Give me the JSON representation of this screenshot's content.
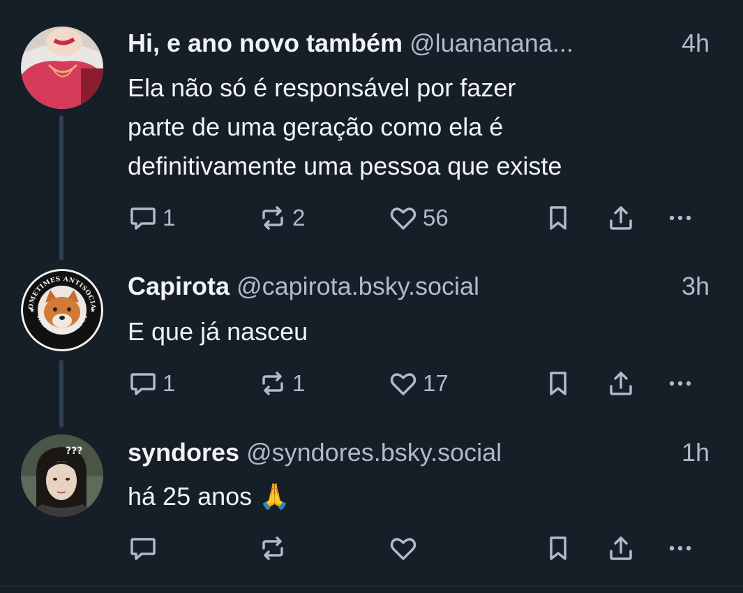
{
  "posts": [
    {
      "display_name": "Hi, e ano novo também",
      "handle": "@luananana...",
      "time": "4h",
      "text_lines": [
        "Ela não só é responsável por fazer",
        "parte de uma geração como ela é",
        "definitivamente uma pessoa que existe"
      ],
      "replies": "1",
      "reposts": "2",
      "likes": "56",
      "avatar_icon": "woman-in-pink-avatar"
    },
    {
      "display_name": "Capirota",
      "handle": "@capirota.bsky.social",
      "time": "3h",
      "text_lines": [
        "E que já nasceu"
      ],
      "replies": "1",
      "reposts": "1",
      "likes": "17",
      "avatar_icon": "fox-badge-avatar",
      "avatar_badge_top": "SOMETIMES ANTISOCIAL",
      "avatar_badge_bottom": "ALWAYS ANTIFASCIST"
    },
    {
      "display_name": "syndores",
      "handle": "@syndores.bsky.social",
      "time": "1h",
      "text_lines": [
        "há 25 anos 🙏"
      ],
      "replies": "",
      "reposts": "",
      "likes": "",
      "avatar_icon": "dark-hair-person-avatar",
      "avatar_badge_text": "???"
    }
  ],
  "colors": {
    "background": "#161e27",
    "text": "#f1f3f5",
    "muted": "#aebbc9",
    "thread_line": "#2e4052"
  },
  "icons": [
    "reply-icon",
    "repost-icon",
    "like-icon",
    "bookmark-icon",
    "share-icon",
    "more-icon"
  ]
}
